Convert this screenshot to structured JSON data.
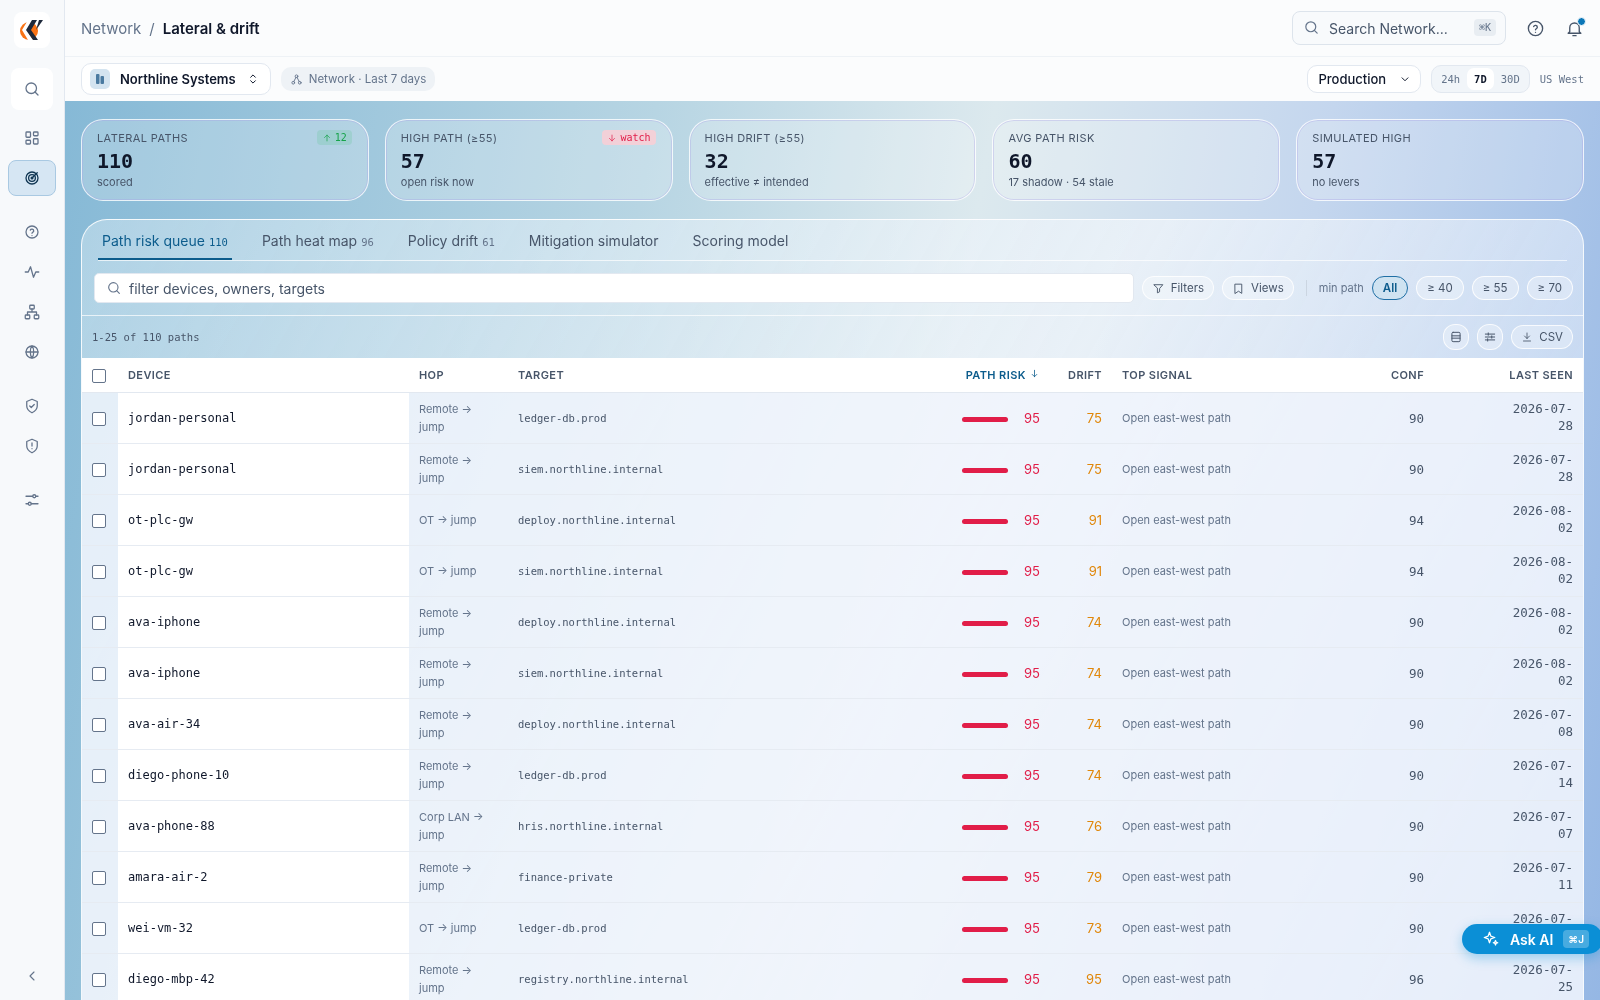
{
  "sidebar": {
    "items": [
      {
        "kind": "search",
        "selected": false
      },
      {
        "kind": "grid",
        "selected": false
      },
      {
        "kind": "radar",
        "selected": true
      },
      {
        "kind": "help",
        "selected": false
      },
      {
        "kind": "activity",
        "selected": false
      },
      {
        "kind": "network",
        "selected": false
      },
      {
        "kind": "globe",
        "selected": false
      },
      {
        "kind": "shield-check",
        "selected": false
      },
      {
        "kind": "shield-alert",
        "selected": false
      },
      {
        "kind": "sliders",
        "selected": false
      }
    ]
  },
  "breadcrumb": [
    "Network",
    "Lateral & drift"
  ],
  "breadcrumb_separator": "/",
  "search": {
    "placeholder": "Search Network...",
    "shortcut": "⌘K"
  },
  "notifications": {
    "unread": true
  },
  "org": "Northline Systems",
  "scope": "Network · Last 7 days",
  "environment": "Production",
  "ranges": [
    {
      "label": "24h",
      "selected": false
    },
    {
      "label": "7D",
      "selected": true
    },
    {
      "label": "30D",
      "selected": false
    }
  ],
  "region": "US West",
  "kpis": [
    {
      "label": "LATERAL PATHS",
      "value": "110",
      "sub": "scored",
      "badge": {
        "text": "12",
        "kind": "up"
      }
    },
    {
      "label": "HIGH PATH (≥55)",
      "value": "57",
      "sub": "open risk now",
      "badge": {
        "text": "watch",
        "kind": "down"
      }
    },
    {
      "label": "HIGH DRIFT (≥55)",
      "value": "32",
      "sub": "effective ≠ intended"
    },
    {
      "label": "AVG PATH RISK",
      "value": "60",
      "sub": "17 shadow · 54 stale"
    },
    {
      "label": "SIMULATED HIGH",
      "value": "57",
      "sub": "no levers"
    }
  ],
  "tabs": [
    {
      "label": "Path risk queue",
      "count": "110",
      "selected": true
    },
    {
      "label": "Path heat map",
      "count": "96",
      "selected": false
    },
    {
      "label": "Policy drift",
      "count": "61",
      "selected": false
    },
    {
      "label": "Mitigation simulator",
      "selected": false
    },
    {
      "label": "Scoring model",
      "selected": false
    }
  ],
  "filter": {
    "placeholder": "filter devices, owners, targets"
  },
  "filter_buttons": [
    "Filters",
    "Views"
  ],
  "min_path": {
    "label": "min path",
    "options": [
      {
        "label": "All",
        "selected": true
      },
      {
        "label": "≥ 40",
        "selected": false
      },
      {
        "label": "≥ 55",
        "selected": false
      },
      {
        "label": "≥ 70",
        "selected": false
      }
    ]
  },
  "range_text": "1-25 of 110 paths",
  "export": "CSV",
  "table": {
    "all_checked": false,
    "columns": [
      {
        "label": "DEVICE",
        "sorted": false
      },
      {
        "label": "HOP",
        "sorted": false
      },
      {
        "label": "TARGET",
        "sorted": false
      },
      {
        "label": "PATH RISK",
        "sorted": true
      },
      {
        "label": "DRIFT",
        "sorted": false
      },
      {
        "label": "TOP SIGNAL",
        "sorted": false
      },
      {
        "label": "CONF",
        "sorted": false
      },
      {
        "label": "LAST SEEN",
        "sorted": false
      }
    ],
    "rows": [
      {
        "checked": false,
        "device": "jordan-personal",
        "hop": "Remote → jump",
        "target": "ledger-db.prod",
        "risk": "95",
        "drift": "75",
        "signal": "Open east-west path",
        "conf": "90",
        "last_seen": "2026-07-28"
      },
      {
        "checked": false,
        "device": "jordan-personal",
        "hop": "Remote → jump",
        "target": "siem.northline.internal",
        "risk": "95",
        "drift": "75",
        "signal": "Open east-west path",
        "conf": "90",
        "last_seen": "2026-07-28"
      },
      {
        "checked": false,
        "device": "ot-plc-gw",
        "hop": "OT → jump",
        "target": "deploy.northline.internal",
        "risk": "95",
        "drift": "91",
        "signal": "Open east-west path",
        "conf": "94",
        "last_seen": "2026-08-02"
      },
      {
        "checked": false,
        "device": "ot-plc-gw",
        "hop": "OT → jump",
        "target": "siem.northline.internal",
        "risk": "95",
        "drift": "91",
        "signal": "Open east-west path",
        "conf": "94",
        "last_seen": "2026-08-02"
      },
      {
        "checked": false,
        "device": "ava-iphone",
        "hop": "Remote → jump",
        "target": "deploy.northline.internal",
        "risk": "95",
        "drift": "74",
        "signal": "Open east-west path",
        "conf": "90",
        "last_seen": "2026-08-02"
      },
      {
        "checked": false,
        "device": "ava-iphone",
        "hop": "Remote → jump",
        "target": "siem.northline.internal",
        "risk": "95",
        "drift": "74",
        "signal": "Open east-west path",
        "conf": "90",
        "last_seen": "2026-08-02"
      },
      {
        "checked": false,
        "device": "ava-air-34",
        "hop": "Remote → jump",
        "target": "deploy.northline.internal",
        "risk": "95",
        "drift": "74",
        "signal": "Open east-west path",
        "conf": "90",
        "last_seen": "2026-07-08"
      },
      {
        "checked": false,
        "device": "diego-phone-10",
        "hop": "Remote → jump",
        "target": "ledger-db.prod",
        "risk": "95",
        "drift": "74",
        "signal": "Open east-west path",
        "conf": "90",
        "last_seen": "2026-07-14"
      },
      {
        "checked": false,
        "device": "ava-phone-88",
        "hop": "Corp LAN → jump",
        "target": "hris.northline.internal",
        "risk": "95",
        "drift": "76",
        "signal": "Open east-west path",
        "conf": "90",
        "last_seen": "2026-07-07"
      },
      {
        "checked": false,
        "device": "amara-air-2",
        "hop": "Remote → jump",
        "target": "finance-private",
        "risk": "95",
        "drift": "79",
        "signal": "Open east-west path",
        "conf": "90",
        "last_seen": "2026-07-11"
      },
      {
        "checked": false,
        "device": "wei-vm-32",
        "hop": "OT → jump",
        "target": "ledger-db.prod",
        "risk": "95",
        "drift": "73",
        "signal": "Open east-west path",
        "conf": "90",
        "last_seen": "2026-07-"
      },
      {
        "checked": false,
        "device": "diego-mbp-42",
        "hop": "Remote → jump",
        "target": "registry.northline.internal",
        "risk": "95",
        "drift": "95",
        "signal": "Open east-west path",
        "conf": "96",
        "last_seen": "2026-07-25"
      }
    ]
  },
  "assistant": {
    "label": "Ask AI",
    "shortcut": "⌘J"
  }
}
